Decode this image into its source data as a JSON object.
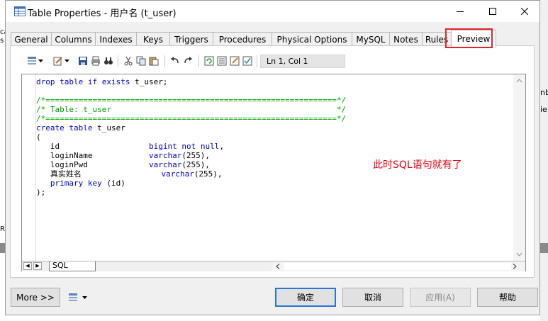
{
  "window": {
    "title": "Table Properties - 用户名 (t_user)"
  },
  "tabs": [
    {
      "label": "General"
    },
    {
      "label": "Columns"
    },
    {
      "label": "Indexes"
    },
    {
      "label": "Keys"
    },
    {
      "label": "Triggers"
    },
    {
      "label": "Procedures"
    },
    {
      "label": "Physical Options"
    },
    {
      "label": "MySQL"
    },
    {
      "label": "Notes"
    },
    {
      "label": "Rules"
    },
    {
      "label": "Preview",
      "active": true
    }
  ],
  "toolbar": {
    "cursor_position": "Ln 1, Col 1",
    "icons": [
      "format-icon",
      "dropdown-icon",
      "edit-icon",
      "dropdown-icon",
      "save-icon",
      "print-icon",
      "find-icon",
      "cut-icon",
      "copy-icon",
      "paste-icon",
      "undo-icon",
      "redo-icon",
      "refresh-icon",
      "preview-list-icon",
      "edit-doc-icon",
      "checkbox-doc-icon"
    ]
  },
  "editor": {
    "lines": [
      "drop table if exists t_user;",
      "",
      "/*==============================================================*/",
      "/* Table: t_user                                                */",
      "/*==============================================================*/",
      "create table t_user",
      "(",
      "   id                   bigint not null,",
      "   loginName            varchar(255),",
      "   loginPwd             varchar(255),",
      "   真实姓名                 varchar(255),",
      "   primary key (id)",
      ");"
    ],
    "sheet_tab": "SQL",
    "annotation": "此时SQL语句就有了"
  },
  "buttons": {
    "more": "More >>",
    "ok": "确定",
    "cancel": "取消",
    "apply": "应用(A)",
    "help": "帮助"
  },
  "background": {
    "left_fragments": [
      "ca",
      "s",
      "Re"
    ],
    "right_fragments": [
      "nb",
      "ie"
    ]
  }
}
